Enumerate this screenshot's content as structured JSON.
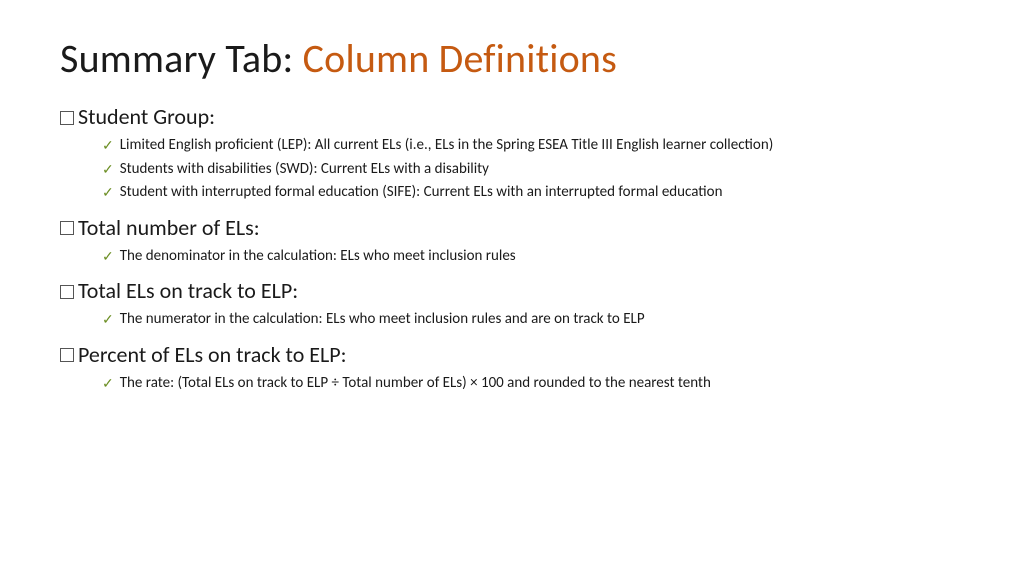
{
  "title": {
    "part1": "Summary Tab: ",
    "part2": "Column Definitions"
  },
  "sections": [
    {
      "header": "Student Group:",
      "items": [
        "Limited English proficient (LEP): All current ELs (i.e., ELs in the Spring ESEA Title III English learner collection)",
        "Students with disabilities (SWD): Current ELs with a disability",
        "Student with interrupted formal education (SIFE): Current ELs with an interrupted formal education"
      ]
    },
    {
      "header": "Total number of ELs:",
      "items": [
        "The denominator in the calculation: ELs who meet inclusion rules"
      ]
    },
    {
      "header": "Total ELs on track to ELP:",
      "items": [
        "The numerator in the calculation: ELs who meet inclusion rules and are on track to ELP"
      ]
    },
    {
      "header": "Percent of ELs on track to ELP:",
      "items": [
        "The rate: (Total ELs on track to ELP ÷ Total number of ELs) × 100 and rounded to the nearest tenth"
      ]
    }
  ]
}
